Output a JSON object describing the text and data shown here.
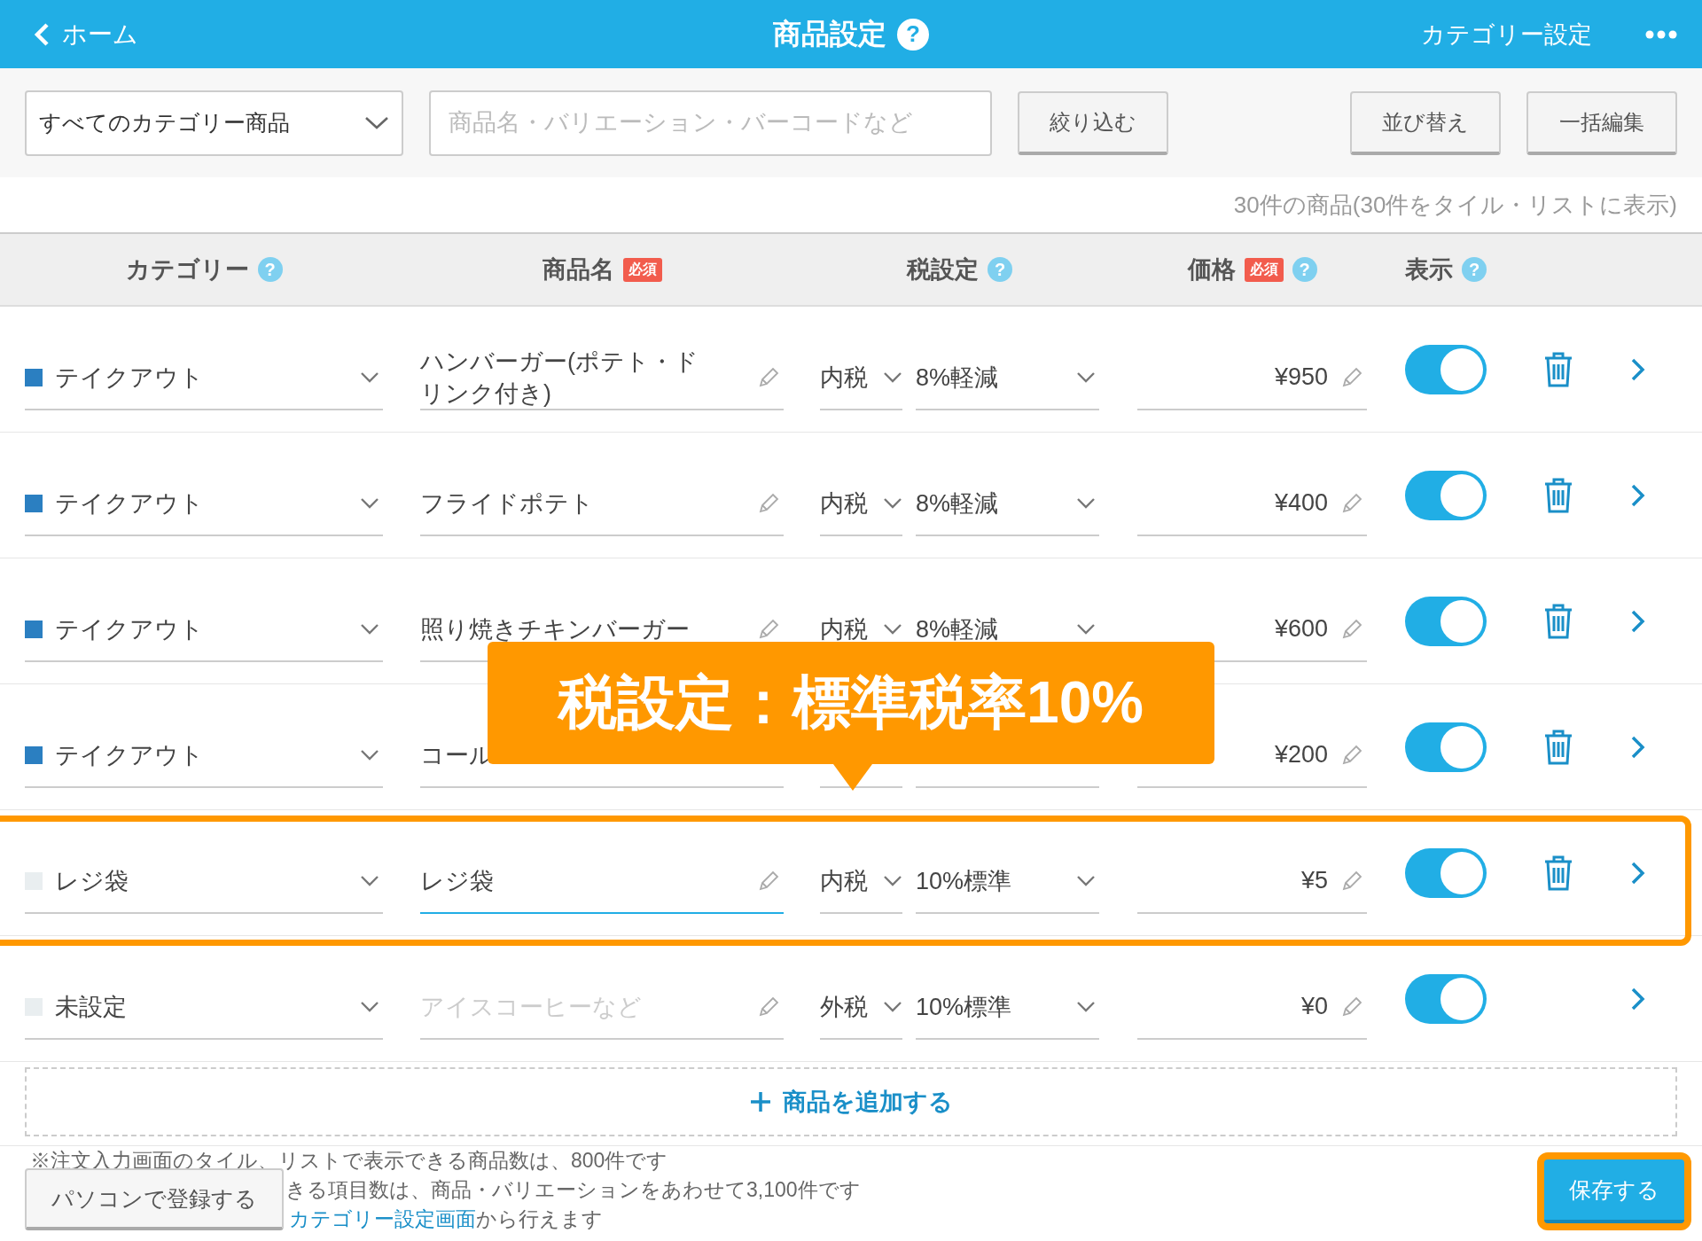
{
  "header": {
    "back": "ホーム",
    "title": "商品設定",
    "help": "?",
    "right_link": "カテゴリー設定"
  },
  "toolbar": {
    "category_select": "すべてのカテゴリー商品",
    "search": {
      "placeholder": "商品名・バリエーション・バーコードなど"
    },
    "filter_button": "絞り込む",
    "sort_button": "並び替え",
    "bulk_button": "一括編集"
  },
  "count": "30件の商品(30件をタイル・リストに表示)",
  "columns": [
    {
      "label": "カテゴリー",
      "help": "?"
    },
    {
      "label": "商品名",
      "required": "必須"
    },
    {
      "label": "税設定",
      "help": "?"
    },
    {
      "label": "価格",
      "required": "必須",
      "help": "?"
    },
    {
      "label": "表示",
      "help": "?"
    }
  ],
  "rows": [
    {
      "category": "テイクアウト",
      "color": "#2b7fc1",
      "name": "ハンバーガー(ポテト・ドリンク付き)",
      "focused": false,
      "tax_type": "内税",
      "tax_rate": "8%軽減",
      "price": "¥950",
      "on": true,
      "deletable": true,
      "highlighted": false
    },
    {
      "category": "テイクアウト",
      "color": "#2b7fc1",
      "name": "フライドポテト",
      "focused": false,
      "tax_type": "内税",
      "tax_rate": "8%軽減",
      "price": "¥400",
      "on": true,
      "deletable": true,
      "highlighted": false
    },
    {
      "category": "テイクアウト",
      "color": "#2b7fc1",
      "name": "照り焼きチキンバーガー",
      "focused": false,
      "tax_type": "内税",
      "tax_rate": "8%軽減",
      "price": "¥600",
      "on": true,
      "deletable": true,
      "highlighted": false
    },
    {
      "category": "テイクアウト",
      "color": "#2b7fc1",
      "name": "コール",
      "focused": false,
      "price": "¥200",
      "on": true,
      "deletable": true,
      "highlighted": false
    },
    {
      "category": "レジ袋",
      "color": "#e9eef0",
      "name": "レジ袋",
      "focused": true,
      "tax_type": "内税",
      "tax_rate": "10%標準",
      "price": "¥5",
      "on": true,
      "deletable": true,
      "highlighted": true
    },
    {
      "category": "未設定",
      "color": "#e9eef0",
      "placeholder": "アイスコーヒーなど",
      "focused": false,
      "tax_type": "外税",
      "tax_rate": "10%標準",
      "price": "¥0",
      "on": true,
      "deletable": false,
      "highlighted": false
    }
  ],
  "add_button": "商品を追加する",
  "callout": {
    "text": "税設定：標準税率10%"
  },
  "notes": [
    {
      "text": "※注文入力画面のタイル、リストで表示できる商品数は、800件です"
    },
    {
      "text": "きる項目数は、商品・バリエーションをあわせて3,100件です"
    },
    {
      "link": "カテゴリー設定画面",
      "text": "から行えます"
    }
  ],
  "footer": {
    "pc_button": "パソコンで登録する",
    "save_button": "保存する",
    "save_highlighted": true
  }
}
